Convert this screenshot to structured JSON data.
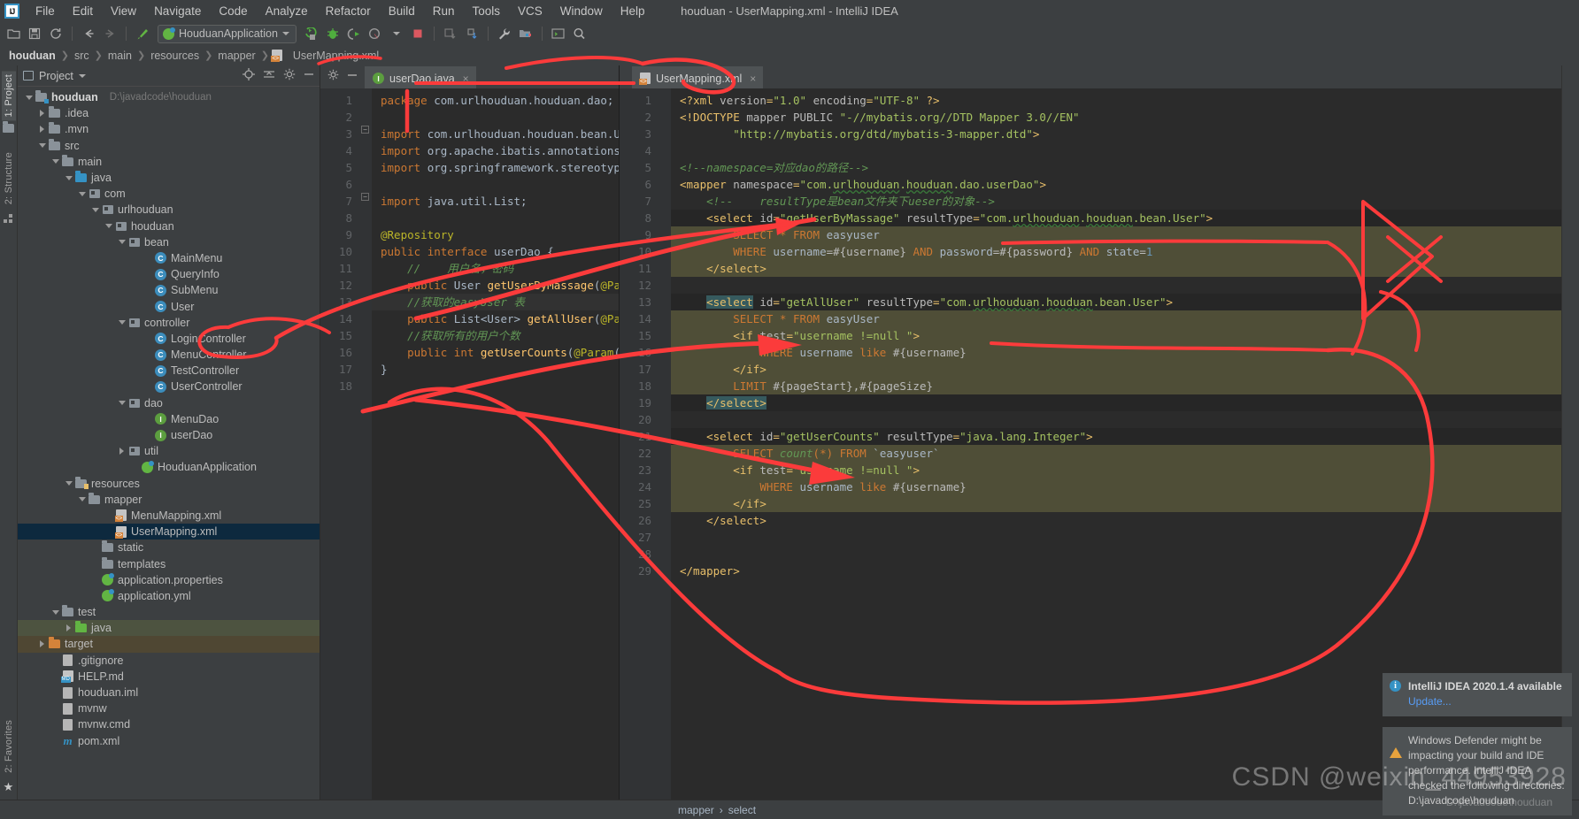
{
  "window": {
    "title": "houduan - UserMapping.xml - IntelliJ IDEA",
    "logo": "IJ"
  },
  "menu": [
    {
      "label": "File"
    },
    {
      "label": "Edit"
    },
    {
      "label": "View"
    },
    {
      "label": "Navigate"
    },
    {
      "label": "Code"
    },
    {
      "label": "Analyze"
    },
    {
      "label": "Refactor"
    },
    {
      "label": "Build"
    },
    {
      "label": "Run"
    },
    {
      "label": "Tools"
    },
    {
      "label": "VCS"
    },
    {
      "label": "Window"
    },
    {
      "label": "Help"
    }
  ],
  "toolbar": {
    "run_config": "HouduanApplication",
    "icons": [
      "open-folder-icon",
      "save-icon",
      "sync-icon",
      "back-arrow-icon",
      "forward-arrow-icon",
      "build-hammer-icon",
      "run-icon",
      "debug-icon",
      "run-coverage-icon",
      "profile-icon",
      "stop-icon",
      "update-app-icon",
      "pull-icon",
      "settings-wrench-icon",
      "project-structure-icon",
      "terminal-icon",
      "search-everywhere-icon"
    ]
  },
  "breadcrumb": [
    "houduan",
    "src",
    "main",
    "resources",
    "mapper",
    "UserMapping.xml"
  ],
  "left_strip": [
    {
      "label": "1: Project",
      "active": true
    },
    {
      "label": "2: Structure",
      "active": false
    },
    {
      "label": "2: Favorites",
      "active": false
    }
  ],
  "project_panel": {
    "title": "Project",
    "actions": [
      "locate-icon",
      "collapse-all-icon",
      "settings-icon",
      "hide-icon"
    ],
    "tree": [
      {
        "label": "houduan",
        "path": "D:\\javadcode\\houduan",
        "indent": 0,
        "arrow": "open",
        "icon": "module-folder",
        "bold": true
      },
      {
        "label": ".idea",
        "indent": 1,
        "arrow": "closed",
        "icon": "folder"
      },
      {
        "label": ".mvn",
        "indent": 1,
        "arrow": "closed",
        "icon": "folder"
      },
      {
        "label": "src",
        "indent": 1,
        "arrow": "open",
        "icon": "folder"
      },
      {
        "label": "main",
        "indent": 2,
        "arrow": "open",
        "icon": "folder"
      },
      {
        "label": "java",
        "indent": 3,
        "arrow": "open",
        "icon": "folder-blue"
      },
      {
        "label": "com",
        "indent": 4,
        "arrow": "open",
        "icon": "package"
      },
      {
        "label": "urlhouduan",
        "indent": 5,
        "arrow": "open",
        "icon": "package"
      },
      {
        "label": "houduan",
        "indent": 6,
        "arrow": "open",
        "icon": "package"
      },
      {
        "label": "bean",
        "indent": 7,
        "arrow": "open",
        "icon": "package"
      },
      {
        "label": "MainMenu",
        "indent": 9,
        "arrow": "none",
        "icon": "class"
      },
      {
        "label": "QueryInfo",
        "indent": 9,
        "arrow": "none",
        "icon": "class"
      },
      {
        "label": "SubMenu",
        "indent": 9,
        "arrow": "none",
        "icon": "class"
      },
      {
        "label": "User",
        "indent": 9,
        "arrow": "none",
        "icon": "class"
      },
      {
        "label": "controller",
        "indent": 7,
        "arrow": "open",
        "icon": "package"
      },
      {
        "label": "LoginController",
        "indent": 9,
        "arrow": "none",
        "icon": "class"
      },
      {
        "label": "MenuController",
        "indent": 9,
        "arrow": "none",
        "icon": "class"
      },
      {
        "label": "TestController",
        "indent": 9,
        "arrow": "none",
        "icon": "class"
      },
      {
        "label": "UserController",
        "indent": 9,
        "arrow": "none",
        "icon": "class"
      },
      {
        "label": "dao",
        "indent": 7,
        "arrow": "open",
        "icon": "package"
      },
      {
        "label": "MenuDao",
        "indent": 9,
        "arrow": "none",
        "icon": "interface"
      },
      {
        "label": "userDao",
        "indent": 9,
        "arrow": "none",
        "icon": "interface"
      },
      {
        "label": "util",
        "indent": 7,
        "arrow": "closed",
        "icon": "package"
      },
      {
        "label": "HouduanApplication",
        "indent": 8,
        "arrow": "none",
        "icon": "spring"
      },
      {
        "label": "resources",
        "indent": 3,
        "arrow": "open",
        "icon": "folder-resources"
      },
      {
        "label": "mapper",
        "indent": 4,
        "arrow": "open",
        "icon": "folder"
      },
      {
        "label": "MenuMapping.xml",
        "indent": 6,
        "arrow": "none",
        "icon": "xml"
      },
      {
        "label": "UserMapping.xml",
        "indent": 6,
        "arrow": "none",
        "icon": "xml",
        "selected": true
      },
      {
        "label": "static",
        "indent": 5,
        "arrow": "none",
        "icon": "folder"
      },
      {
        "label": "templates",
        "indent": 5,
        "arrow": "none",
        "icon": "folder"
      },
      {
        "label": "application.properties",
        "indent": 5,
        "arrow": "none",
        "icon": "spring"
      },
      {
        "label": "application.yml",
        "indent": 5,
        "arrow": "none",
        "icon": "spring"
      },
      {
        "label": "test",
        "indent": 2,
        "arrow": "open",
        "icon": "folder"
      },
      {
        "label": "java",
        "indent": 3,
        "arrow": "closed",
        "icon": "folder-green",
        "highlight": "green"
      },
      {
        "label": "target",
        "indent": 1,
        "arrow": "closed",
        "icon": "folder-orange",
        "highlight": "brown"
      },
      {
        "label": ".gitignore",
        "indent": 2,
        "arrow": "none",
        "icon": "ignore-file"
      },
      {
        "label": "HELP.md",
        "indent": 2,
        "arrow": "none",
        "icon": "markdown"
      },
      {
        "label": "houduan.iml",
        "indent": 2,
        "arrow": "none",
        "icon": "iml-file"
      },
      {
        "label": "mvnw",
        "indent": 2,
        "arrow": "none",
        "icon": "script-file"
      },
      {
        "label": "mvnw.cmd",
        "indent": 2,
        "arrow": "none",
        "icon": "cmd-file"
      },
      {
        "label": "pom.xml",
        "indent": 2,
        "arrow": "none",
        "icon": "maven"
      }
    ]
  },
  "editor_left": {
    "tab": {
      "label": "userDao.java",
      "icon": "interface-icon",
      "close": "×"
    },
    "lines": [
      {
        "n": 1,
        "html": "<span class=\"kw\">package</span> <span class=\"txt\">com.urlhouduan.houduan.dao;</span>"
      },
      {
        "n": 2,
        "html": ""
      },
      {
        "n": 3,
        "html": "<span class=\"kw\">import</span> <span class=\"txt\">com.urlhouduan.houduan.bean.User;</span>",
        "fold": true
      },
      {
        "n": 4,
        "html": "<span class=\"kw\">import</span> <span class=\"txt\">org.apache.ibatis.annotations.Par</span>"
      },
      {
        "n": 5,
        "html": "<span class=\"kw\">import</span> <span class=\"txt\">org.springframework.stereotype.Re</span>"
      },
      {
        "n": 6,
        "html": ""
      },
      {
        "n": 7,
        "html": "<span class=\"kw\">import</span> <span class=\"txt\">java.util.List;</span>",
        "fold": true
      },
      {
        "n": 8,
        "html": ""
      },
      {
        "n": 9,
        "html": "<span class=\"ann\">@Repository</span>",
        "marker": "bean"
      },
      {
        "n": 10,
        "html": "<span class=\"kw\">public</span> <span class=\"kw\">interface</span> <span class=\"txt\">userDao {</span>",
        "marker": "spring"
      },
      {
        "n": 11,
        "html": "    <span class=\"cm\">//    用户名，密码</span>"
      },
      {
        "n": 12,
        "html": "    <span class=\"kw\">public</span> <span class=\"txt\">User</span> <span class=\"fn\">getUserByMassage</span><span class=\"txt\">(</span><span class=\"ann\">@Param</span><span class=\"txt\">(</span>"
      },
      {
        "n": 13,
        "html": "    <span class=\"cm\">//获取的easyUser 表</span>",
        "hl": true
      },
      {
        "n": 14,
        "html": "    <span class=\"kw\">public</span> <span class=\"txt\">List&lt;User&gt;</span> <span class=\"fn\">getAllUser</span><span class=\"txt\">(</span><span class=\"ann\">@Param</span>"
      },
      {
        "n": 15,
        "html": "    <span class=\"cm\">//获取所有的用户个数</span>"
      },
      {
        "n": 16,
        "html": "    <span class=\"kw\">public</span> <span class=\"kw\">int</span> <span class=\"fn\">getUserCounts</span><span class=\"txt\">(</span><span class=\"ann\">@Param</span><span class=\"txt\">(</span><span class=\"str\">\"use</span>"
      },
      {
        "n": 17,
        "html": "<span class=\"txt\">}</span>"
      },
      {
        "n": 18,
        "html": ""
      }
    ]
  },
  "editor_right": {
    "tab": {
      "label": "UserMapping.xml",
      "icon": "xml-icon",
      "close": "×"
    },
    "lines": [
      {
        "n": 1,
        "html": "<span class=\"tag\">&lt;?</span><span class=\"tag\">xml</span> <span class=\"attr\">version</span><span class=\"tag\">=</span><span class=\"val\">\"1.0\"</span> <span class=\"attr\">encoding</span><span class=\"tag\">=</span><span class=\"val\">\"UTF-8\"</span> <span class=\"tag\">?&gt;</span>"
      },
      {
        "n": 2,
        "html": "<span class=\"tag\">&lt;!DOCTYPE</span> <span class=\"attr\">mapper</span> <span class=\"attr\">PUBLIC</span> <span class=\"val\">\"-//mybatis.org//DTD Mapper 3.0//EN\"</span>"
      },
      {
        "n": 3,
        "html": "        <span class=\"val\">\"http://mybatis.org/dtd/mybatis-3-mapper.dtd\"</span><span class=\"tag\">&gt;</span>"
      },
      {
        "n": 4,
        "html": ""
      },
      {
        "n": 5,
        "html": "<span class=\"cm\">&lt;!--namespace=对应dao的路径--&gt;</span>"
      },
      {
        "n": 6,
        "html": "<span class=\"tag\">&lt;mapper</span> <span class=\"attr\">namespace</span><span class=\"tag\">=</span><span class=\"val\">\"com.<span class=\"squig\">urlhouduan</span>.<span class=\"squig\">houduan</span>.dao.userDao\"</span><span class=\"tag\">&gt;</span>",
        "fold": true
      },
      {
        "n": 7,
        "html": "    <span class=\"cm\">&lt;!--    resultType是bean文件夹下ueser的对象--&gt;</span>"
      },
      {
        "n": 8,
        "html": "    <span class=\"tag\">&lt;select</span> <span class=\"attr\">id</span><span class=\"tag\">=</span><span class=\"val\">\"getUserByMassage\"</span> <span class=\"attr\">resultType</span><span class=\"tag\">=</span><span class=\"val\">\"com.<span class=\"squig\">urlhouduan</span>.<span class=\"squig\">houduan</span>.bean.User\"</span><span class=\"tag\">&gt;</span>",
        "fold": true,
        "darkbg": true
      },
      {
        "n": 9,
        "html": "        <span class=\"sql-kw\">SELECT</span> <span class=\"sql-kw\">*</span> <span class=\"sql-kw\">FROM</span> <span class=\"sql-id\">easyuser</span>",
        "sqlbg": true,
        "fold": true
      },
      {
        "n": 10,
        "html": "        <span class=\"sql-kw\">WHERE</span> <span class=\"sql-id\">username</span>=#{username} <span class=\"sql-kw\">AND</span> <span class=\"sql-id\">password</span>=#{password} <span class=\"sql-kw\">AND</span> <span class=\"sql-id\">state</span>=<span class=\"num\">1</span>",
        "sqlbg": true,
        "fold": true
      },
      {
        "n": 11,
        "html": "    <span class=\"tag\">&lt;/select&gt;</span>",
        "sqlbg": true,
        "fold": true
      },
      {
        "n": 12,
        "html": ""
      },
      {
        "n": 13,
        "html": "    <span class=\"tealsel\"><span class=\"tag\">&lt;select</span></span> <span class=\"attr\">id</span><span class=\"tag\">=</span><span class=\"val\">\"getAllUser\"</span> <span class=\"attr\">resultType</span><span class=\"tag\">=</span><span class=\"val\">\"com.<span class=\"squig\">urlhouduan</span>.<span class=\"squig\">houduan</span>.bean.User\"</span><span class=\"tag\">&gt;</span>",
        "fold": true,
        "darkbg": true
      },
      {
        "n": 14,
        "html": "        <span class=\"sql-kw\">SELECT</span> <span class=\"sql-kw\">*</span> <span class=\"sql-kw\">FROM</span> <span class=\"sql-id\">easyUser</span>",
        "sqlbg": true
      },
      {
        "n": 15,
        "html": "        <span class=\"tag\">&lt;if</span> <span class=\"attr\">test</span><span class=\"tag\">=</span><span class=\"val\">\"username !=null \"</span><span class=\"tag\">&gt;</span>",
        "sqlbg": true,
        "fold": true
      },
      {
        "n": 16,
        "html": "            <span class=\"sql-kw\">WHERE</span> <span class=\"sql-id\">username</span> <span class=\"sql-kw\">like</span> #{username}",
        "sqlbg": true
      },
      {
        "n": 17,
        "html": "        <span class=\"tag\">&lt;/if&gt;</span>",
        "sqlbg": true,
        "fold": true
      },
      {
        "n": 18,
        "html": "        <span class=\"sql-kw\">LIMIT</span> #{pageStart},#{pageSize}",
        "sqlbg": true
      },
      {
        "n": 19,
        "html": "    <span class=\"tealsel\"><span class=\"tag\">&lt;/select&gt;</span></span>",
        "fold": true,
        "darkbg": true
      },
      {
        "n": 20,
        "html": ""
      },
      {
        "n": 21,
        "html": "    <span class=\"tag\">&lt;select</span> <span class=\"attr\">id</span><span class=\"tag\">=</span><span class=\"val\">\"getUserCounts\"</span> <span class=\"attr\">resultType</span><span class=\"tag\">=</span><span class=\"val\">\"java.lang.Integer\"</span><span class=\"tag\">&gt;</span>",
        "fold": true,
        "darkbg": true
      },
      {
        "n": 22,
        "html": "        <span class=\"sql-kw\">SELECT</span> <span class=\"cm\">count</span><span class=\"sql-kw\">(*)</span> <span class=\"sql-kw\">FROM</span> <span class=\"sql-id\">`easyuser`</span>",
        "sqlbg": true
      },
      {
        "n": 23,
        "html": "        <span class=\"tag\">&lt;if</span> <span class=\"attr\">test</span><span class=\"tag\">=</span><span class=\"val\">\"username !=null \"</span><span class=\"tag\">&gt;</span>",
        "sqlbg": true,
        "fold": true
      },
      {
        "n": 24,
        "html": "            <span class=\"sql-kw\">WHERE</span> <span class=\"sql-id\">username</span> <span class=\"sql-kw\">like</span> #{username}",
        "sqlbg": true
      },
      {
        "n": 25,
        "html": "        <span class=\"tag\">&lt;/if&gt;</span>",
        "sqlbg": true,
        "fold": true
      },
      {
        "n": 26,
        "html": "    <span class=\"tag\">&lt;/select&gt;</span>",
        "fold": true
      },
      {
        "n": 27,
        "html": ""
      },
      {
        "n": 28,
        "html": ""
      },
      {
        "n": 29,
        "html": "<span class=\"tag\">&lt;/mapper&gt;</span>"
      }
    ]
  },
  "status_bar": {
    "breadcrumbs": [
      "mapper",
      "select"
    ],
    "separator": "›"
  },
  "notifications": [
    {
      "icon": "info-icon",
      "title": "IntelliJ IDEA 2020.1.4 available",
      "link": "Update...",
      "body": ""
    },
    {
      "icon": "warning-icon",
      "title": "",
      "link": "",
      "body": "Windows Defender might be impacting your build and IDE performance. IntelliJ IDEA checked the following directories: D:\\javadcode\\houduan"
    }
  ],
  "watermark": {
    "main": "CSDN @weixin_44953928",
    "sub": "D:\\javadcode\\houduan"
  },
  "colors": {
    "accent_blue": "#3592c4",
    "annotation_red": "#fb3b3b",
    "selection_blue": "#0d293e",
    "sql_block": "#4f4e37",
    "editor_bg": "#2b2b2b",
    "chrome_bg": "#3c3f41"
  }
}
